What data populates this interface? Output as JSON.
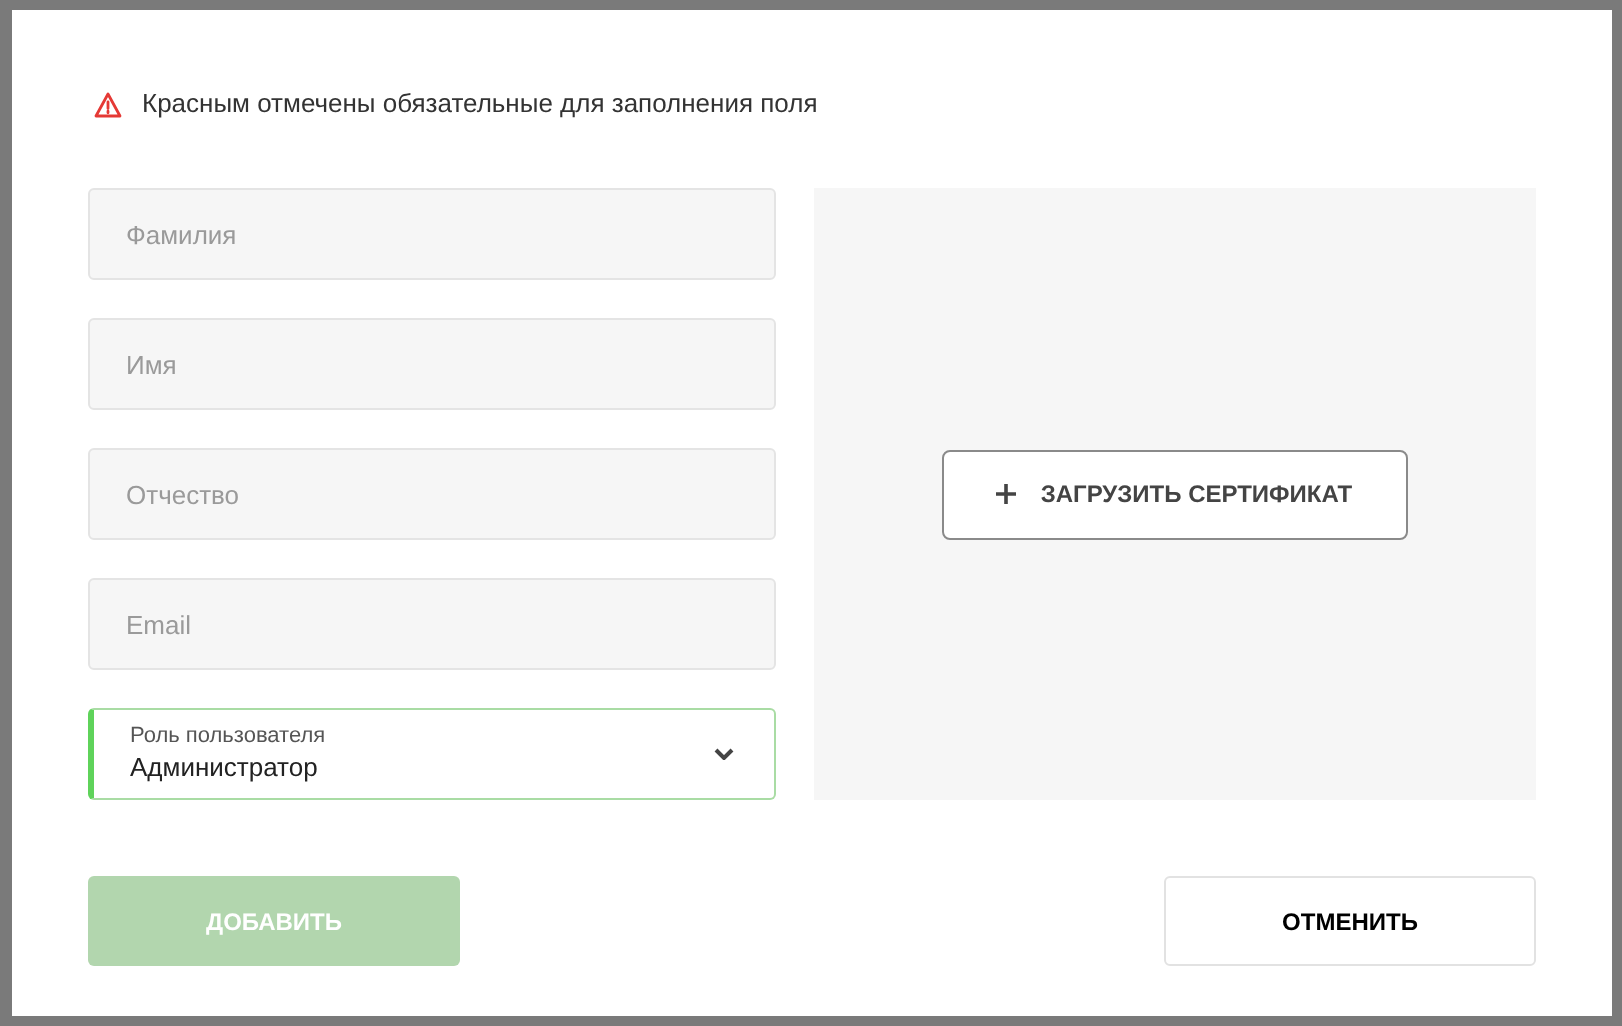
{
  "notice": {
    "text": "Красным отмечены обязательные для заполнения поля"
  },
  "fields": [
    {
      "placeholder": "Фамилия"
    },
    {
      "placeholder": "Имя"
    },
    {
      "placeholder": "Отчество"
    },
    {
      "placeholder": "Email"
    }
  ],
  "role_select": {
    "label": "Роль пользователя",
    "value": "Администратор",
    "focused": true
  },
  "upload_button": {
    "label": "ЗАГРУЗИТЬ СЕРТИФИКАТ"
  },
  "buttons": [
    {
      "label": "ДОБАВИТЬ",
      "kind": "primary",
      "disabled": true
    },
    {
      "label": "ОТМЕНИТЬ",
      "kind": "secondary",
      "disabled": false
    }
  ]
}
